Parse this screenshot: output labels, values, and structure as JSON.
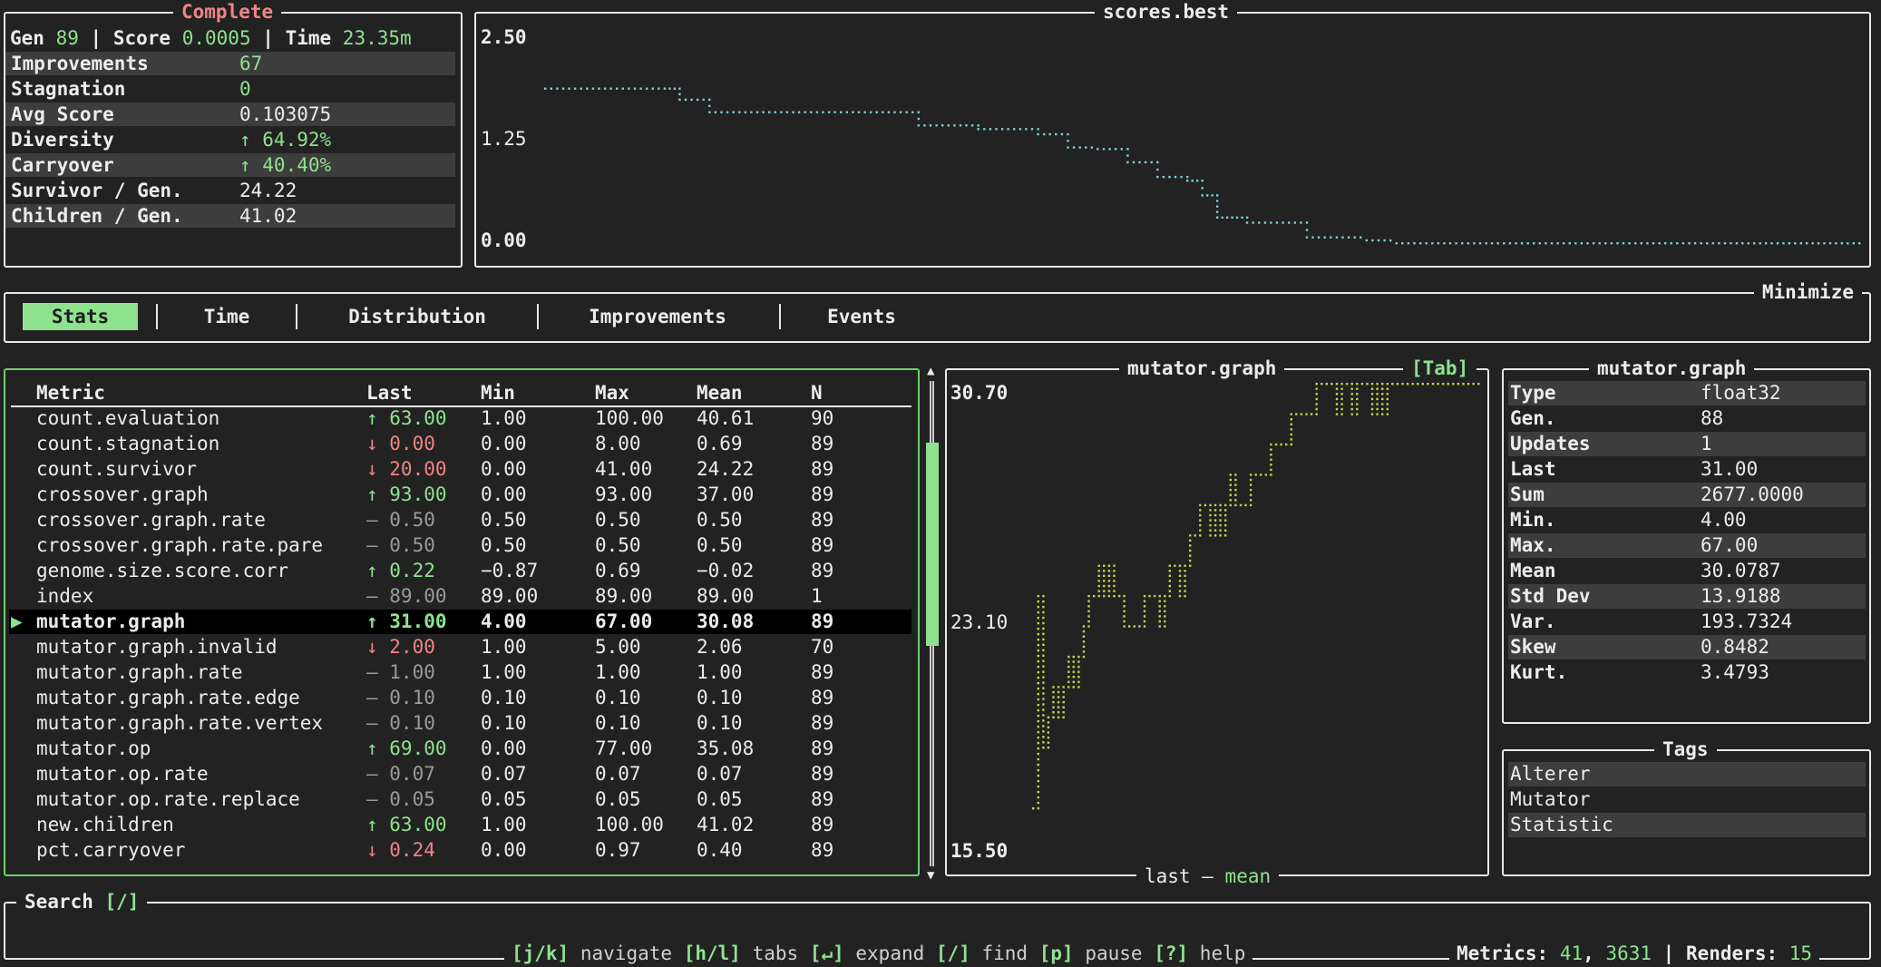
{
  "summary": {
    "status": "Complete",
    "gen_label": "Gen",
    "gen": "89",
    "score_label": "Score",
    "score": "0.0005",
    "time_label": "Time",
    "time": "23.35m",
    "sep": "|",
    "rows": [
      {
        "label": "Improvements",
        "value": "67"
      },
      {
        "label": "Stagnation",
        "value": "0"
      },
      {
        "label": "Avg Score",
        "value": "0.103075"
      },
      {
        "label": "Diversity",
        "value": "↑ 64.92%"
      },
      {
        "label": "Carryover",
        "value": "↑ 40.40%"
      },
      {
        "label": "Survivor / Gen.",
        "value": "24.22"
      },
      {
        "label": "Children / Gen.",
        "value": "41.02"
      }
    ]
  },
  "best_chart": {
    "title": "scores.best",
    "y_ticks": [
      "2.50",
      "1.25",
      "0.00"
    ]
  },
  "chart_data": [
    {
      "type": "line",
      "title": "scores.best",
      "ylim": [
        0.0,
        2.5
      ],
      "x": [
        1,
        5,
        9,
        10,
        12,
        20,
        22,
        26,
        30,
        34,
        36,
        38,
        40,
        42,
        44,
        45,
        46,
        47,
        48,
        52,
        54,
        56,
        58,
        64,
        66,
        70,
        80,
        89
      ],
      "series": [
        {
          "values": [
            2.1,
            2.1,
            2.1,
            1.95,
            1.78,
            1.78,
            1.78,
            1.6,
            1.55,
            1.48,
            1.3,
            1.28,
            1.1,
            0.9,
            0.85,
            0.65,
            0.35,
            0.35,
            0.28,
            0.08,
            0.08,
            0.04,
            0.0,
            0.0,
            0.0,
            0.0,
            0.0,
            0.0
          ]
        }
      ]
    },
    {
      "type": "line",
      "title": "mutator.graph",
      "ylim": [
        15.5,
        30.7
      ],
      "x": [
        1,
        2,
        3,
        4,
        5,
        6,
        7,
        8,
        9,
        10,
        11,
        12,
        13,
        14,
        15,
        16,
        17,
        18,
        19,
        20,
        21,
        22,
        23,
        24,
        25,
        26,
        27,
        28,
        29,
        30,
        31,
        32,
        33,
        34,
        35,
        36,
        37,
        38,
        39,
        40,
        41,
        42,
        43,
        44,
        45,
        46,
        47,
        48,
        49,
        50,
        51,
        52,
        53,
        54,
        55,
        56,
        57,
        58,
        59,
        60,
        61,
        62,
        63,
        64,
        65,
        66,
        67,
        68,
        69,
        70,
        71,
        72,
        73,
        74,
        75,
        76,
        77,
        78,
        79,
        80,
        81,
        82,
        83,
        84,
        85,
        86,
        87,
        88,
        89
      ],
      "series": [
        {
          "name": "last",
          "values": [
            17,
            24,
            19,
            20,
            21,
            20,
            21,
            22,
            21,
            22,
            23,
            24,
            24,
            25,
            24,
            25,
            24,
            24,
            23,
            23,
            23,
            23,
            24,
            24,
            24,
            23,
            24,
            25,
            25,
            24,
            25,
            26,
            26,
            27,
            27,
            26,
            27,
            26,
            27,
            28,
            27,
            27,
            27,
            28,
            28,
            28,
            28,
            29,
            29,
            29,
            29,
            30,
            30,
            30,
            30,
            30,
            31,
            31,
            31,
            31,
            30,
            31,
            31,
            30,
            31,
            31,
            31,
            30,
            31,
            30,
            31,
            31,
            31,
            31,
            31,
            31,
            31,
            31,
            31,
            31,
            31,
            31,
            31,
            31,
            31,
            31,
            31,
            31,
            31
          ]
        },
        {
          "name": "mean",
          "values": []
        }
      ]
    }
  ],
  "tabs": {
    "items": [
      "Stats",
      "Time",
      "Distribution",
      "Improvements",
      "Events"
    ],
    "mode": "Minimize"
  },
  "table": {
    "headers": [
      "Metric",
      "Last",
      "Min",
      "Max",
      "Mean",
      "N"
    ],
    "rows": [
      {
        "name": "count.evaluation",
        "last": "↑ 63.00",
        "min": "1.00",
        "max": "100.00",
        "mean": "40.61",
        "n": "90",
        "trend": "up"
      },
      {
        "name": "count.stagnation",
        "last": "↓ 0.00",
        "min": "0.00",
        "max": "8.00",
        "mean": "0.69",
        "n": "89",
        "trend": "down"
      },
      {
        "name": "count.survivor",
        "last": "↓ 20.00",
        "min": "0.00",
        "max": "41.00",
        "mean": "24.22",
        "n": "89",
        "trend": "down"
      },
      {
        "name": "crossover.graph",
        "last": "↑ 93.00",
        "min": "0.00",
        "max": "93.00",
        "mean": "37.00",
        "n": "89",
        "trend": "up"
      },
      {
        "name": "crossover.graph.rate",
        "last": "– 0.50",
        "min": "0.50",
        "max": "0.50",
        "mean": "0.50",
        "n": "89",
        "trend": "flat"
      },
      {
        "name": "crossover.graph.rate.pare",
        "last": "– 0.50",
        "min": "0.50",
        "max": "0.50",
        "mean": "0.50",
        "n": "89",
        "trend": "flat"
      },
      {
        "name": "genome.size.score.corr",
        "last": "↑ 0.22",
        "min": "−0.87",
        "max": "0.69",
        "mean": "−0.02",
        "n": "89",
        "trend": "up"
      },
      {
        "name": "index",
        "last": "– 89.00",
        "min": "89.00",
        "max": "89.00",
        "mean": "89.00",
        "n": "1",
        "trend": "flat"
      },
      {
        "name": "mutator.graph",
        "last": "↑ 31.00",
        "min": "4.00",
        "max": "67.00",
        "mean": "30.08",
        "n": "89",
        "trend": "up",
        "selected": true
      },
      {
        "name": "mutator.graph.invalid",
        "last": "↓ 2.00",
        "min": "1.00",
        "max": "5.00",
        "mean": "2.06",
        "n": "70",
        "trend": "down"
      },
      {
        "name": "mutator.graph.rate",
        "last": "– 1.00",
        "min": "1.00",
        "max": "1.00",
        "mean": "1.00",
        "n": "89",
        "trend": "flat"
      },
      {
        "name": "mutator.graph.rate.edge",
        "last": "– 0.10",
        "min": "0.10",
        "max": "0.10",
        "mean": "0.10",
        "n": "89",
        "trend": "flat"
      },
      {
        "name": "mutator.graph.rate.vertex",
        "last": "– 0.10",
        "min": "0.10",
        "max": "0.10",
        "mean": "0.10",
        "n": "89",
        "trend": "flat"
      },
      {
        "name": "mutator.op",
        "last": "↑ 69.00",
        "min": "0.00",
        "max": "77.00",
        "mean": "35.08",
        "n": "89",
        "trend": "up"
      },
      {
        "name": "mutator.op.rate",
        "last": "– 0.07",
        "min": "0.07",
        "max": "0.07",
        "mean": "0.07",
        "n": "89",
        "trend": "flat"
      },
      {
        "name": "mutator.op.rate.replace",
        "last": "– 0.05",
        "min": "0.05",
        "max": "0.05",
        "mean": "0.05",
        "n": "89",
        "trend": "flat"
      },
      {
        "name": "new.children",
        "last": "↑ 63.00",
        "min": "1.00",
        "max": "100.00",
        "mean": "41.02",
        "n": "89",
        "trend": "up"
      },
      {
        "name": "pct.carryover",
        "last": "↓ 0.24",
        "min": "0.00",
        "max": "0.97",
        "mean": "0.40",
        "n": "89",
        "trend": "down"
      }
    ],
    "selected_marker": "▶",
    "scroll_fraction": 0.22
  },
  "metric_chart": {
    "title": "mutator.graph",
    "tab_hint": "[Tab]",
    "y_ticks": [
      "30.70",
      "23.10",
      "15.50"
    ],
    "legend_last": "last",
    "legend_sep": "–",
    "legend_mean": "mean"
  },
  "details": {
    "title": "mutator.graph",
    "rows": [
      {
        "label": "Type",
        "value": "float32"
      },
      {
        "label": "Gen.",
        "value": "88"
      },
      {
        "label": "Updates",
        "value": "1"
      },
      {
        "label": "Last",
        "value": "31.00"
      },
      {
        "label": "Sum",
        "value": "2677.0000"
      },
      {
        "label": "Min.",
        "value": "4.00"
      },
      {
        "label": "Max.",
        "value": "67.00"
      },
      {
        "label": "Mean",
        "value": "30.0787"
      },
      {
        "label": "Std Dev",
        "value": "13.9188"
      },
      {
        "label": "Var.",
        "value": "193.7324"
      },
      {
        "label": "Skew",
        "value": "0.8482"
      },
      {
        "label": "Kurt.",
        "value": "3.4793"
      }
    ]
  },
  "tags": {
    "title": "Tags",
    "items": [
      "Alterer",
      "Mutator",
      "Statistic"
    ]
  },
  "search": {
    "title": "Search",
    "hint": "[/]"
  },
  "footer": {
    "keys": [
      {
        "key": "[j/k]",
        "label": "navigate"
      },
      {
        "key": "[h/l]",
        "label": "tabs"
      },
      {
        "key": "[↵]",
        "label": "expand"
      },
      {
        "key": "[/]",
        "label": "find"
      },
      {
        "key": "[p]",
        "label": "pause"
      },
      {
        "key": "[?]",
        "label": "help"
      }
    ],
    "metrics_label": "Metrics:",
    "metrics_a": "41",
    "metrics_b": "3631",
    "renders_label": "Renders:",
    "renders": "15",
    "sep": "|",
    "comma": ","
  },
  "colors": {
    "accent_green": "#8ee28e",
    "down_red": "#f08484",
    "status_red": "#f08484",
    "best_dots": "#7ecfd6",
    "metric_dots": "#c6d24a"
  }
}
